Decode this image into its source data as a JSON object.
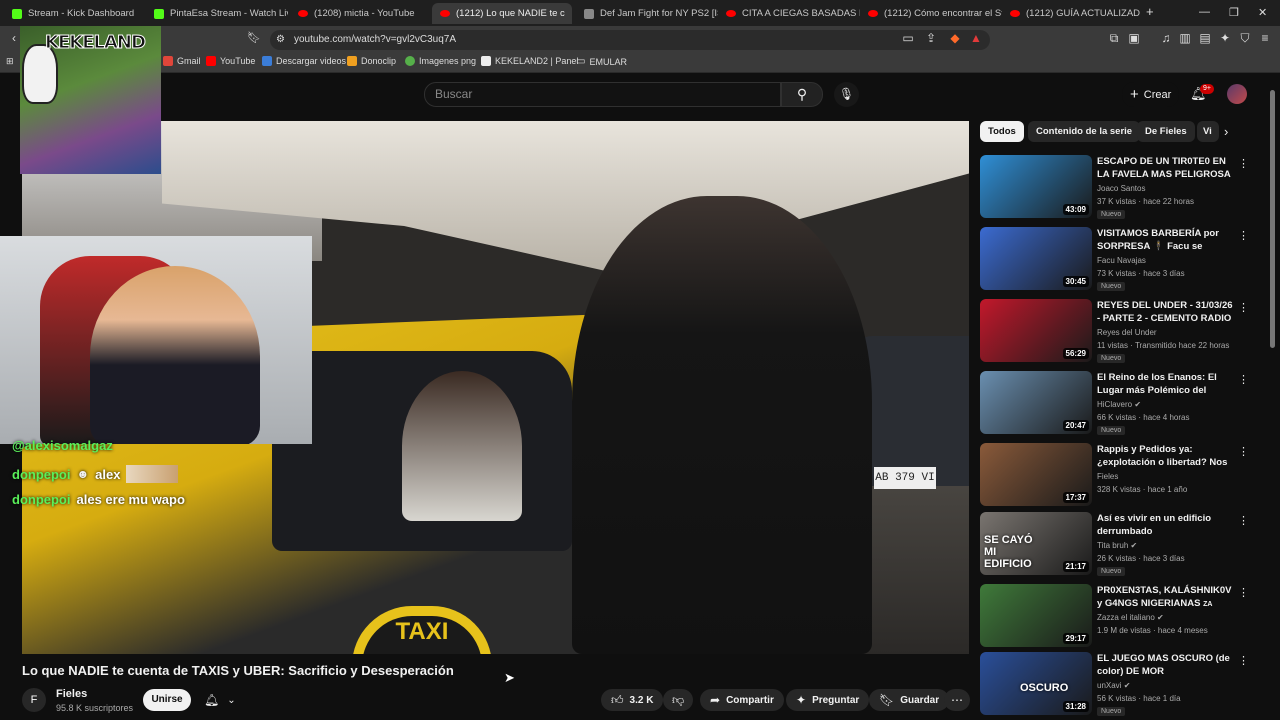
{
  "browser": {
    "tabs": [
      {
        "title": "Stream - Kick Dashboard",
        "icon": "kick"
      },
      {
        "title": "PintaEsa Stream - Watch Live o",
        "icon": "kick"
      },
      {
        "title": "(1208) mictia - YouTube",
        "icon": "youtube"
      },
      {
        "title": "(1212) Lo que NADIE te c",
        "icon": "youtube",
        "active": true
      },
      {
        "title": "Def Jam Fight for NY PS2 [ISO (",
        "icon": "generic"
      },
      {
        "title": "CITA A CIEGAS BASADAS EN S",
        "icon": "youtube"
      },
      {
        "title": "(1212) Cómo encontrar el Stro",
        "icon": "youtube"
      },
      {
        "title": "(1212) GUÍA ACTUALIZADA Y E",
        "icon": "youtube"
      }
    ],
    "new_tab": "+",
    "url": "youtube.com/watch?v=gvl2vC3uq7A",
    "bookmarks": [
      "Gmail",
      "YouTube",
      "Descargar videos",
      "Donoclip",
      "Imagenes png",
      "KEKELAND2 | Panel",
      "EMULAR"
    ]
  },
  "youtube": {
    "search_placeholder": "Buscar",
    "create_label": "Crear",
    "notifications_badge": "9+"
  },
  "overlay": {
    "logo_text": "KEKELAND",
    "chat": [
      {
        "user": "@alexisomalgaz",
        "msg": ""
      },
      {
        "user": "donpepoi",
        "msg": "alex"
      },
      {
        "user": "donpepoi",
        "msg": "ales ere mu wapo"
      }
    ]
  },
  "video": {
    "title": "Lo que NADIE te cuenta de TAXIS y UBER: Sacrificio y Desesperación",
    "plate": "AB 379 VI",
    "taxi_sign": "TAXI",
    "channel": {
      "name": "Fieles",
      "subscribers": "95.8 K suscriptores",
      "avatar": "F"
    },
    "join_label": "Unirse",
    "likes": "3.2 K",
    "share_label": "Compartir",
    "ask_label": "Preguntar",
    "save_label": "Guardar"
  },
  "sidebar": {
    "chips": [
      "Todos",
      "Contenido de la serie",
      "De Fieles",
      "Vi"
    ],
    "recommendations": [
      {
        "title": "ESCAPO DE UN TIR0TE0 EN LA FAVELA MAS PELIGROSA DE ...",
        "channel": "Joaco Santos",
        "meta": "37 K vistas · hace 22 horas",
        "badge": "Nuevo",
        "duration": "43:09",
        "thumb": "#2f8fd6",
        "verified": false
      },
      {
        "title": "VISITAMOS BARBERÍA por SORPRESA 🕴 Facu se CORT...",
        "channel": "Facu Navajas",
        "meta": "73 K vistas · hace 3 días",
        "badge": "Nuevo",
        "duration": "30:45",
        "thumb": "#3b6bd1",
        "verified": false
      },
      {
        "title": "REYES DEL UNDER - 31/03/26 - PARTE 2 - CEMENTO RADIO ...",
        "channel": "Reyes del Under",
        "meta": "11 vistas · Transmitido hace 22 horas",
        "badge": "Nuevo",
        "duration": "56:29",
        "thumb": "#c2182b",
        "verified": false
      },
      {
        "title": "El Reino de los Enanos: El Lugar más Polémico del Mundo",
        "channel": "HiClavero",
        "meta": "66 K vistas · hace 4 horas",
        "badge": "Nuevo",
        "duration": "20:47",
        "thumb": "#6a8fb0",
        "verified": true
      },
      {
        "title": "Rappis y Pedidos ya: ¿explotación o libertad? Nos ...",
        "channel": "Fieles",
        "meta": "328 K vistas · hace 1 año",
        "badge": "",
        "duration": "17:37",
        "thumb": "#8a5a3a",
        "verified": false
      },
      {
        "title": "Así es vivir en un edificio derrumbado",
        "channel": "Tita bruh",
        "meta": "26 K vistas · hace 3 días",
        "badge": "Nuevo",
        "duration": "21:17",
        "thumb": "#7a7570",
        "verified": true,
        "overlay": "SE CAYÓ MI EDIFICIO"
      },
      {
        "title": "PR0XEN3TAS, KALÁSHNIK0V y G4NGS NIGERIANAS",
        "channel": "Zazza el italiano",
        "meta": "1.9 M de vistas · hace 4 meses",
        "badge": "",
        "duration": "29:17",
        "thumb": "#3f7a3a",
        "verified": true,
        "title_suffix": "ZA"
      },
      {
        "title": "EL JUEGO MAS OSCURO (de color) DE MOR",
        "channel": "unXavi",
        "meta": "56 K vistas · hace 1 día",
        "badge": "Nuevo",
        "duration": "31:28",
        "thumb": "#2a4f9a",
        "verified": true,
        "overlay": "OSCURO"
      }
    ]
  }
}
